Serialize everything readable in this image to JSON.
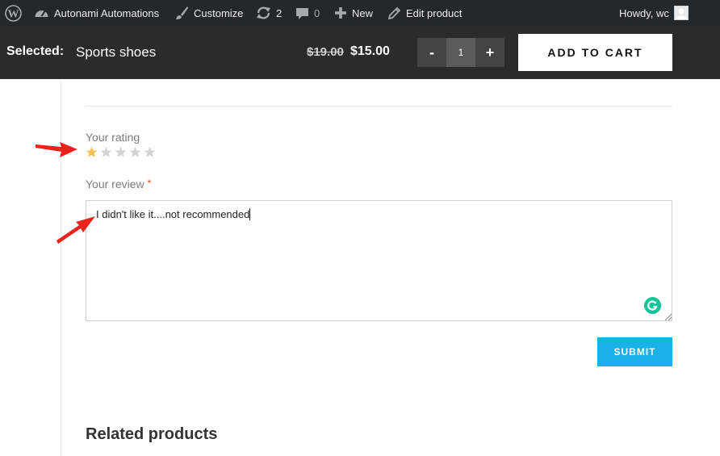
{
  "admin_bar": {
    "site_name": "Autonami Automations",
    "customize": "Customize",
    "updates_count": "2",
    "comments_count": "0",
    "new": "New",
    "edit_product": "Edit product",
    "greeting": "Howdy, wc"
  },
  "cart_bar": {
    "selected_label": "Selected:",
    "product_name": "Sports shoes",
    "price_old": "$19.00",
    "price_new": "$15.00",
    "qty_minus": "-",
    "quantity": "1",
    "qty_plus": "+",
    "add_to_cart": "ADD TO CART"
  },
  "review_form": {
    "rating_label": "Your rating",
    "rating_value": 1,
    "rating_max": 5,
    "review_label": "Your review",
    "required_mark": "*",
    "review_text": "I didn't like it....not recommended",
    "submit": "SUBMIT"
  },
  "related_heading": "Related products",
  "colors": {
    "admin_bar_bg": "#23282d",
    "cart_bar_bg": "#2b2b2b",
    "star_filled": "#f5c24c",
    "star_empty": "#d3d3d3",
    "submit_bg": "#1ab0e8",
    "annotation_arrow": "#e8231c"
  },
  "icons": {
    "wordpress": "wordpress-logo-icon",
    "dashboard": "dashboard-icon",
    "customize": "paintbrush-icon",
    "updates": "refresh-icon",
    "comments": "comment-bubble-icon",
    "new": "plus-icon",
    "edit": "pencil-icon",
    "grammarly": "grammarly-icon"
  }
}
